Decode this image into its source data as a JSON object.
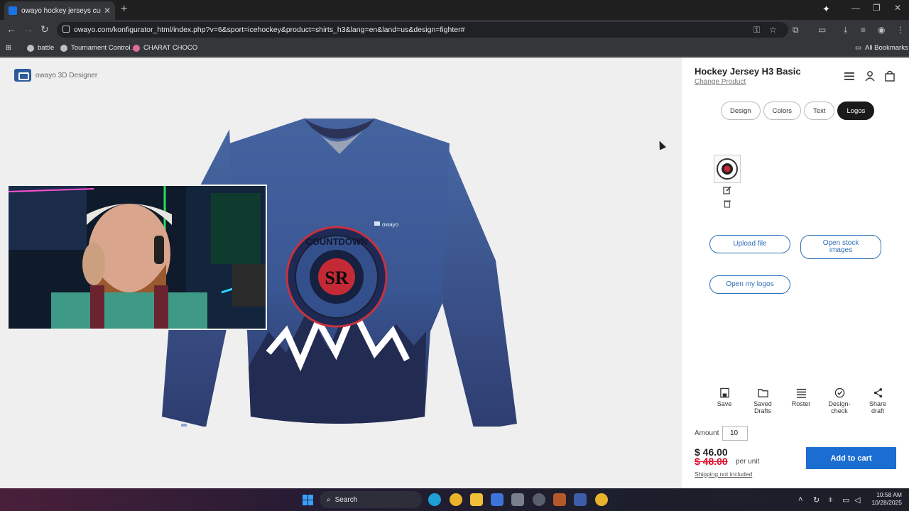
{
  "browser": {
    "tab_title": "owayo hockey jerseys custom m",
    "url": "owayo.com/konfigurator_html/index.php?v=6&sport=icehockey&product=shirts_h3&lang=en&land=us&design=fighter#",
    "bookmarks": [
      "battle",
      "Tournament Control...",
      "CHARAT CHOCO"
    ],
    "all_bookmarks": "All Bookmarks"
  },
  "designer": {
    "brand": "owayo 3D Designer",
    "jersey_brand_text": "owayo",
    "crest_text": "COUNTDOWN",
    "crest_initials": "SR"
  },
  "sidebar": {
    "product_title": "Hockey Jersey H3 Basic",
    "change_product": "Change Product",
    "tabs": [
      {
        "label": "Design",
        "active": false
      },
      {
        "label": "Colors",
        "active": false
      },
      {
        "label": "Text",
        "active": false
      },
      {
        "label": "Logos",
        "active": true
      }
    ],
    "upload_file": "Upload file",
    "open_stock_images": "Open stock images",
    "open_my_logos": "Open my logos",
    "actions": [
      {
        "label": "Save",
        "icon": "save-icon"
      },
      {
        "label": "Saved Drafts",
        "icon": "folder-icon"
      },
      {
        "label": "Roster",
        "icon": "list-icon"
      },
      {
        "label": "Design-check",
        "icon": "check-circle-icon"
      },
      {
        "label": "Share draft",
        "icon": "share-icon"
      }
    ],
    "amount_label": "Amount",
    "amount_value": "10",
    "price": "$ 46.00",
    "old_price": "$ 48.00",
    "per_unit": "per unit",
    "shipping": "Shipping not included",
    "add_to_cart": "Add to cart"
  },
  "taskbar": {
    "search": "Search",
    "time": "10:58 AM",
    "date": "10/28/2025"
  },
  "colors": {
    "jersey_blue": "#3b5a98",
    "jersey_navy": "#232c52",
    "accent_blue": "#1b6dd1",
    "sale_red": "#e00b2a"
  }
}
